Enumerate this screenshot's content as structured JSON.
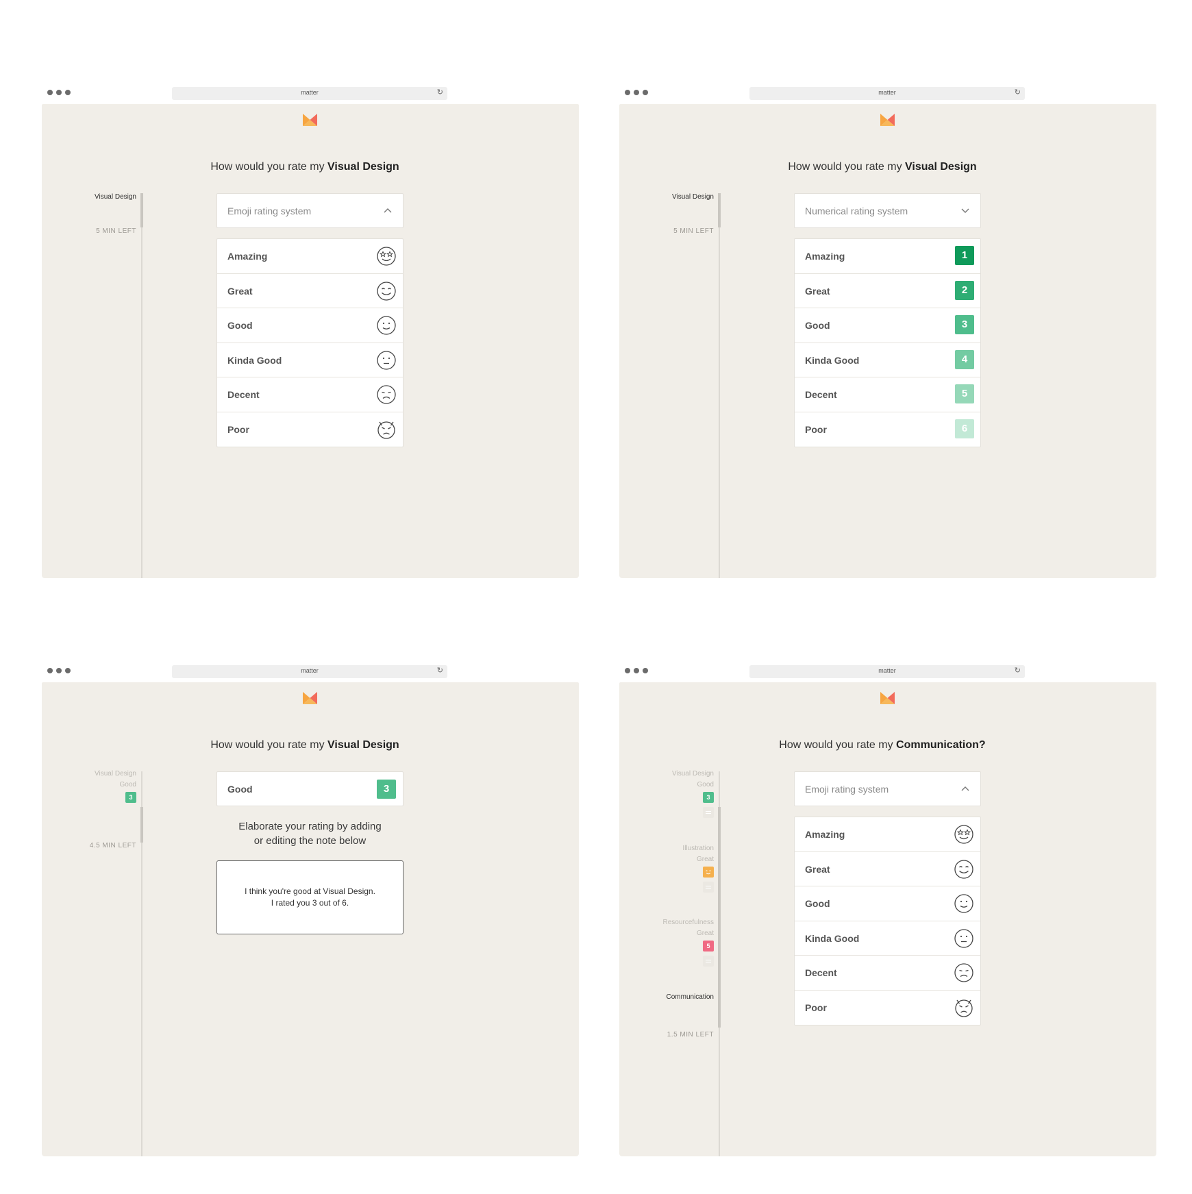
{
  "browser": {
    "url": "matter",
    "reload_icon": "reload-icon"
  },
  "colors": {
    "logo_orange": "#f7a541",
    "logo_coral": "#f26b5b",
    "rating_1": "#0f9a5a",
    "rating_2": "#2ead74",
    "rating_3": "#4fbd8c",
    "rating_4": "#73cba2",
    "rating_5": "#95d8b8",
    "rating_6": "#c2e9d6",
    "illustration_badge": "#f5b04d",
    "resourcefulness_badge": "#f06a83"
  },
  "ratings": [
    "Amazing",
    "Great",
    "Good",
    "Kinda Good",
    "Decent",
    "Poor"
  ],
  "emoji_icons": [
    "star-eyes-icon",
    "grin-icon",
    "smile-icon",
    "neutral-icon",
    "frown-icon",
    "devil-icon"
  ],
  "numbers": [
    "1",
    "2",
    "3",
    "4",
    "5",
    "6"
  ],
  "w1": {
    "question_prefix": "How would you rate my ",
    "question_topic": "Visual Design",
    "sidebar_label": "Visual Design",
    "time_left": "5 MIN LEFT",
    "select_label": "Emoji rating system"
  },
  "w2": {
    "question_prefix": "How would you rate my ",
    "question_topic": "Visual Design",
    "sidebar_label": "Visual Design",
    "time_left": "5 MIN LEFT",
    "select_label": "Numerical rating system"
  },
  "w3": {
    "question_prefix": "How would you rate my ",
    "question_topic": "Visual Design",
    "sidebar_label": "Visual Design",
    "sidebar_rating": "Good",
    "sidebar_badge": "3",
    "time_left": "4.5 MIN LEFT",
    "answer_label": "Good",
    "answer_value": "3",
    "elaborate_line1": "Elaborate your rating by adding",
    "elaborate_line2": "or editing the note below",
    "note_line1": "I think you're good at Visual Design.",
    "note_line2": "I rated you 3 out of 6."
  },
  "w4": {
    "question_prefix": "How would you rate my ",
    "question_topic": "Communication?",
    "sidebar": [
      {
        "label": "Visual Design",
        "rating": "Good",
        "badge": "3"
      },
      {
        "label": "Illustration",
        "rating": "Great"
      },
      {
        "label": "Resourcefulness",
        "rating": "Great",
        "badge": "5"
      }
    ],
    "current_label": "Communication",
    "time_left": "1.5 MIN LEFT",
    "select_label": "Emoji rating system"
  }
}
